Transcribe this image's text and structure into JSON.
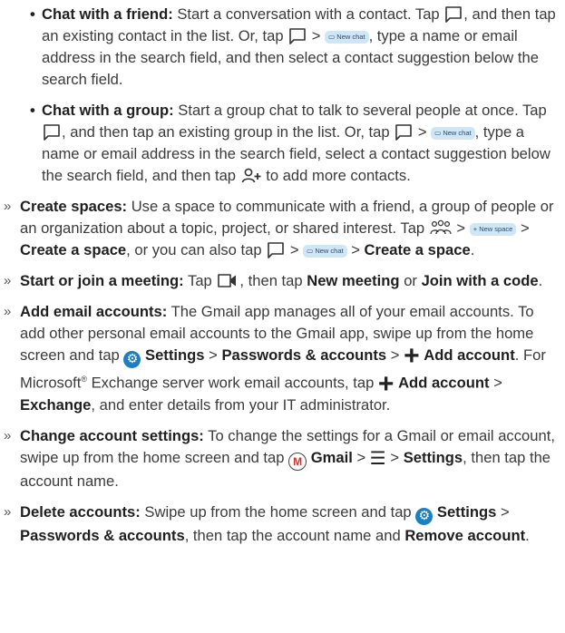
{
  "gt": ">",
  "chips": {
    "new_chat": "New chat",
    "new_space": "+ New space"
  },
  "chat_friend": {
    "title": "Chat with a friend:",
    "t1": " Start a conversation with a contact. Tap ",
    "t2": ", and then tap an existing contact in the list. Or, tap ",
    "t3": ", type a name or email address in the search field, and then select a contact suggestion below the search field."
  },
  "chat_group": {
    "title": "Chat with a group:",
    "t1": " Start a group chat to talk to several people at once. Tap ",
    "t2": ", and then tap an existing group in the list. Or, tap ",
    "t3": ", type a name or email address in the search field, select a contact suggestion below the search field, and then tap ",
    "t4": " to add more contacts."
  },
  "spaces": {
    "title": "Create spaces:",
    "t1": " Use a space to communicate with a friend, a group of people or an organization about a topic, project, or shared interest. Tap ",
    "b1": "Create a space",
    "t2": ", or you can also tap ",
    "b2": "Create a space"
  },
  "meeting": {
    "title": "Start or join a meeting:",
    "t1": " Tap ",
    "t2": ", then tap ",
    "b1": "New meeting",
    "t3": " or ",
    "b2": "Join with a code"
  },
  "email": {
    "title": "Add email accounts:",
    "t1": " The Gmail app manages all of your email accounts. To add other personal email accounts to the Gmail app, swipe up from the home screen and tap ",
    "b_settings": "Settings",
    "b_pw": "Passwords & accounts",
    "b_add": "Add account",
    "t2": ". For Microsoft",
    "reg": "®",
    "t3": " Exchange server work email accounts, tap ",
    "b_add2": "Add account",
    "b_exch": "Exchange",
    "t4": ", and enter details from your IT administrator."
  },
  "change": {
    "title": "Change account settings:",
    "t1": " To change the settings for a Gmail or email account, swipe up from the home screen and tap ",
    "b_gmail": "Gmail",
    "b_settings": "Settings",
    "t2": ", then tap the account name."
  },
  "delete": {
    "title": "Delete accounts:",
    "t1": " Swipe up from the home screen and tap ",
    "b_settings": "Settings",
    "b_pw": "Passwords & accounts",
    "t2": ", then tap the account name and ",
    "b_remove": "Remove account"
  }
}
